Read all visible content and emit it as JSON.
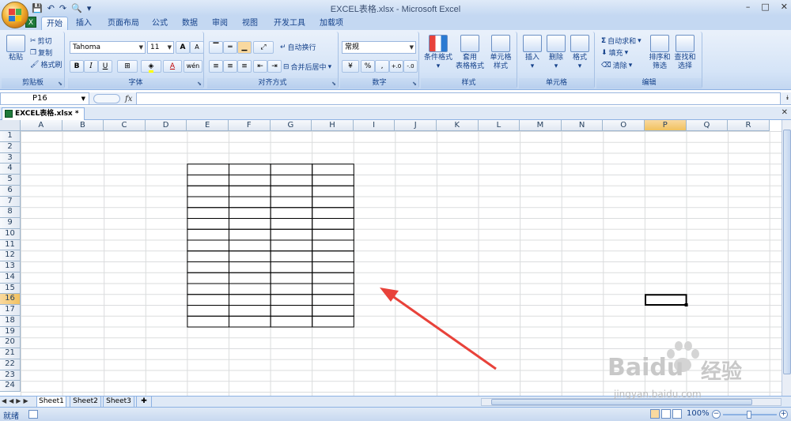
{
  "window": {
    "title": "EXCEL表格.xlsx - Microsoft Excel",
    "controls": [
      "–",
      "□",
      "✕"
    ]
  },
  "ribbon_tabs": [
    "开始",
    "插入",
    "页面布局",
    "公式",
    "数据",
    "审阅",
    "视图",
    "开发工具",
    "加载项"
  ],
  "active_tab": "开始",
  "clipboard": {
    "paste": "粘贴",
    "cut": "剪切",
    "copy": "复制",
    "format_painter": "格式刷",
    "label": "剪贴板"
  },
  "font": {
    "name": "Tahoma",
    "size": "11",
    "label": "字体",
    "bold": "B",
    "italic": "I",
    "underline": "U",
    "grow": "A",
    "shrink": "A",
    "font_color": "A",
    "phonetic": "wén"
  },
  "alignment": {
    "wrap_text": "自动换行",
    "merge_center": "合并后居中",
    "label": "对齐方式"
  },
  "number": {
    "format": "常规",
    "percent": "%",
    "comma": ",",
    "inc_decimal": "+.0",
    "dec_decimal": "-.0",
    "label": "数字"
  },
  "styles": {
    "conditional": "条件格式",
    "table_format_1": "套用",
    "table_format_2": "表格格式",
    "cell_styles_1": "单元格",
    "cell_styles_2": "样式",
    "label": "样式"
  },
  "cells": {
    "insert": "插入",
    "delete": "删除",
    "format": "格式",
    "label": "单元格"
  },
  "editing": {
    "autosum": "自动求和",
    "fill": "填充",
    "clear": "清除",
    "sort_1": "排序和",
    "sort_2": "筛选",
    "find_1": "查找和",
    "find_2": "选择",
    "label": "编辑"
  },
  "formula_bar": {
    "name_box": "P16",
    "fx": "fx",
    "value": ""
  },
  "document_tab": "EXCEL表格.xlsx *",
  "columns": [
    "A",
    "B",
    "C",
    "D",
    "E",
    "F",
    "G",
    "H",
    "I",
    "J",
    "K",
    "L",
    "M",
    "N",
    "O",
    "P",
    "Q",
    "R"
  ],
  "rows": [
    "1",
    "2",
    "3",
    "4",
    "5",
    "6",
    "7",
    "8",
    "9",
    "10",
    "11",
    "12",
    "13",
    "14",
    "15",
    "16",
    "17",
    "18",
    "19",
    "20",
    "21",
    "22",
    "23",
    "24"
  ],
  "selected_cell": {
    "col": "P",
    "row": "16"
  },
  "bordered_range": {
    "start_col": "E",
    "end_col": "H",
    "start_row": "4",
    "end_row": "18"
  },
  "sheets": [
    "Sheet1",
    "Sheet2",
    "Sheet3"
  ],
  "active_sheet": "Sheet1",
  "status": {
    "mode": "就绪",
    "zoom": "100%"
  },
  "colors": {
    "accent": "#f1c15f",
    "arrow": "#e8423a",
    "grid": "#dadcdd"
  },
  "watermark": {
    "brand": "Baidu",
    "cn": "经验",
    "url": "jingyan.baidu.com"
  }
}
